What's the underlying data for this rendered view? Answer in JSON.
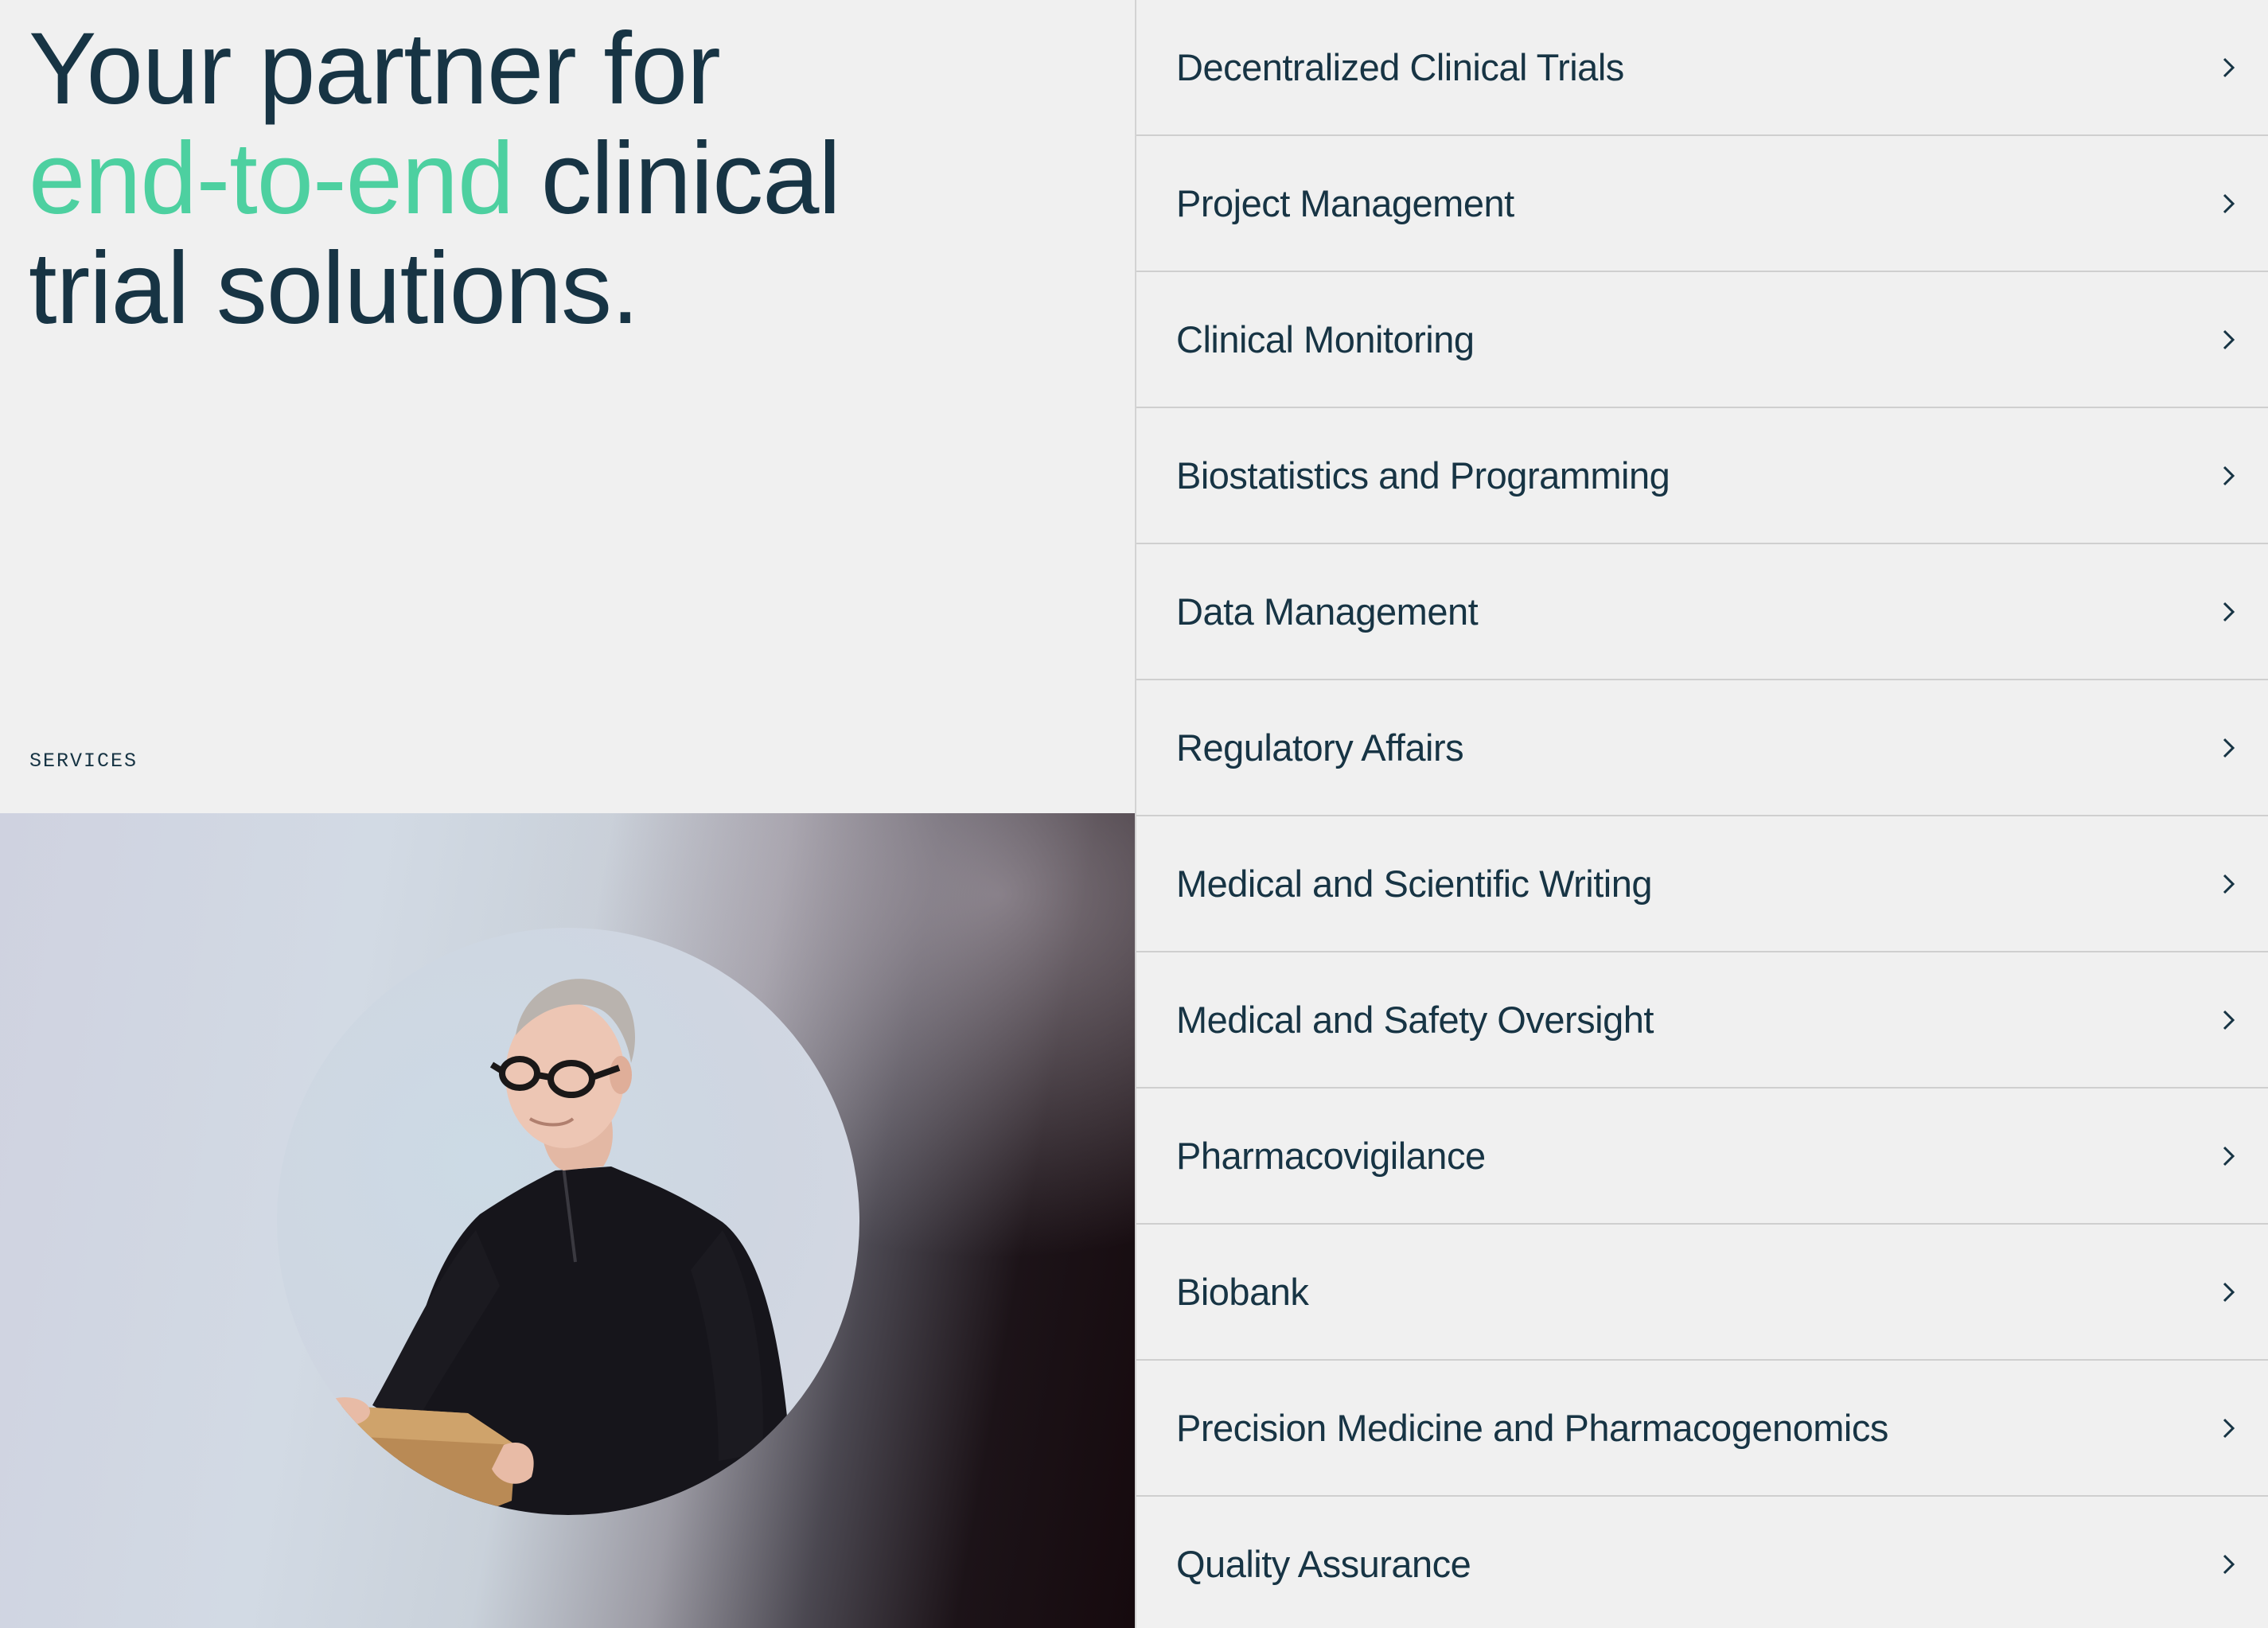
{
  "hero": {
    "headline_line1": "Your partner for",
    "headline_accent": "end-to-end",
    "headline_line2_rest": " clinical",
    "headline_line3": "trial solutions.",
    "section_label": "SERVICES"
  },
  "photo": {
    "description_icon": "photo-circle-elderly-man-holding-box"
  },
  "colors": {
    "text": "#173444",
    "accent": "#4dd0a0",
    "background": "#f0f0f0",
    "divider": "#cfcfcf"
  },
  "services": {
    "items": [
      {
        "label": "Decentralized Clinical Trials",
        "icon": "chevron-right-icon"
      },
      {
        "label": "Project Management",
        "icon": "chevron-right-icon"
      },
      {
        "label": "Clinical Monitoring",
        "icon": "chevron-right-icon"
      },
      {
        "label": "Biostatistics and Programming",
        "icon": "chevron-right-icon"
      },
      {
        "label": "Data Management",
        "icon": "chevron-right-icon"
      },
      {
        "label": "Regulatory Affairs",
        "icon": "chevron-right-icon"
      },
      {
        "label": "Medical and Scientific Writing",
        "icon": "chevron-right-icon"
      },
      {
        "label": "Medical and Safety Oversight",
        "icon": "chevron-right-icon"
      },
      {
        "label": "Pharmacovigilance",
        "icon": "chevron-right-icon"
      },
      {
        "label": "Biobank",
        "icon": "chevron-right-icon"
      },
      {
        "label": "Precision Medicine and Pharmacogenomics",
        "icon": "chevron-right-icon"
      },
      {
        "label": "Quality Assurance",
        "icon": "chevron-right-icon"
      }
    ]
  }
}
